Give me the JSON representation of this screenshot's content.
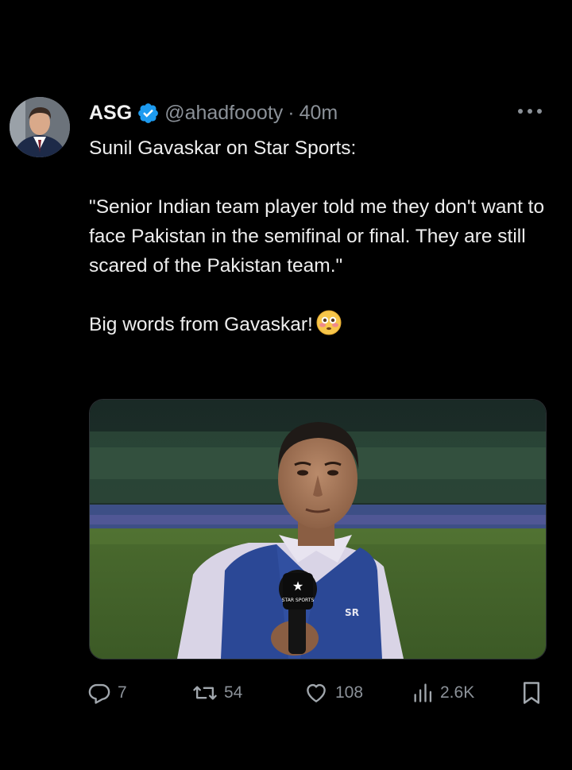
{
  "tweet": {
    "author_name": "ASG",
    "handle": "@ahadfoooty",
    "separator": "·",
    "time": "40m",
    "lines": [
      "Sunil Gavaskar on Star Sports:",
      "\"Senior Indian team player told me they don't want to face Pakistan in the semifinal or final. They are still scared of the Pakistan team.\"",
      "Big words from Gavaskar!"
    ],
    "emoji": "flushed-face-emoji",
    "verified": true
  },
  "media": {
    "mic_label": "STAR SPORTS",
    "jacket_logo": "SR"
  },
  "actions": {
    "replies": "7",
    "reposts": "54",
    "likes": "108",
    "views": "2.6K"
  },
  "icons": [
    "more-icon",
    "verified-icon",
    "reply-icon",
    "repost-icon",
    "like-icon",
    "views-icon",
    "bookmark-icon"
  ],
  "colors": {
    "background": "#000000",
    "text": "#e7e9ea",
    "muted": "#8b9198",
    "verified_blue": "#1d9bf0"
  }
}
